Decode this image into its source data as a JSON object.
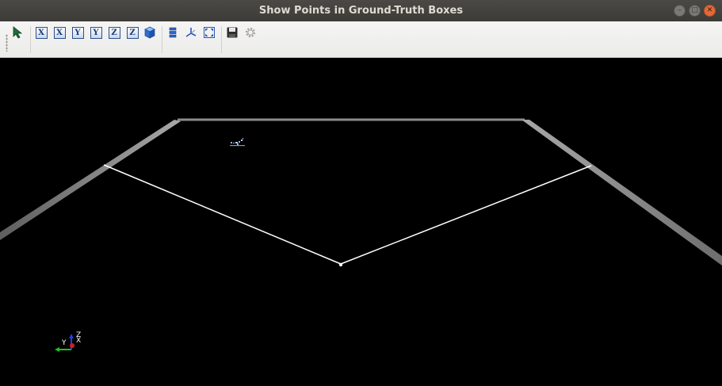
{
  "window": {
    "title": "Show Points in Ground-Truth Boxes",
    "buttons": [
      "minimize",
      "maximize",
      "close"
    ]
  },
  "toolbar": {
    "buttons": [
      {
        "name": "interact-tool-button",
        "icon": "pointer-arrow-icon"
      },
      {
        "name": "view-x-front-button",
        "icon": "axis-view-icon",
        "label": "X"
      },
      {
        "name": "view-x-back-button",
        "icon": "axis-view-icon",
        "label": "X"
      },
      {
        "name": "view-y-front-button",
        "icon": "axis-view-icon",
        "label": "Y"
      },
      {
        "name": "view-y-back-button",
        "icon": "axis-view-icon",
        "label": "Y"
      },
      {
        "name": "view-z-front-button",
        "icon": "axis-view-icon",
        "label": "Z"
      },
      {
        "name": "view-z-back-button",
        "icon": "axis-view-icon",
        "label": "Z"
      },
      {
        "name": "isometric-view-button",
        "icon": "cube-icon"
      },
      {
        "name": "layers-button",
        "icon": "layers-icon"
      },
      {
        "name": "axes-button",
        "icon": "axes-icon"
      },
      {
        "name": "fit-view-button",
        "icon": "fit-view-icon"
      },
      {
        "name": "save-button",
        "icon": "save-icon"
      },
      {
        "name": "settings-button",
        "icon": "gear-icon"
      }
    ]
  },
  "axes_triad": {
    "z": "Z",
    "x": "X",
    "y": "Y"
  },
  "colors": {
    "title_bg": "#3c3b37",
    "toolbar_bg": "#efeeed",
    "viewport_bg": "#000000",
    "plane_edge": "#9a9a9a",
    "line": "#ffffff",
    "point_cluster": "#8fb3ff",
    "axis_x": "#d02020",
    "axis_y": "#20c020",
    "axis_z": "#2040e0"
  }
}
